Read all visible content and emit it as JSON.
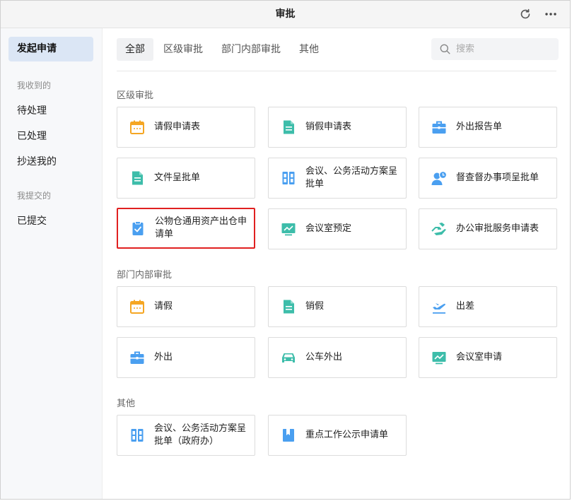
{
  "titlebar": {
    "title": "审批",
    "refresh_icon": "refresh-icon",
    "more_icon": "more-icon"
  },
  "sidebar": {
    "active": "发起申请",
    "group_received": "我收到的",
    "pending": "待处理",
    "processed": "已处理",
    "cc_me": "抄送我的",
    "group_submitted": "我提交的",
    "submitted": "已提交"
  },
  "tabs": [
    "全部",
    "区级审批",
    "部门内部审批",
    "其他"
  ],
  "search": {
    "placeholder": "搜索"
  },
  "sections": {
    "district": {
      "title": "区级审批",
      "cards": [
        {
          "label": "请假申请表",
          "icon": "calendar-icon"
        },
        {
          "label": "销假申请表",
          "icon": "document-icon"
        },
        {
          "label": "外出报告单",
          "icon": "briefcase-icon"
        },
        {
          "label": "文件呈批单",
          "icon": "document-icon"
        },
        {
          "label": "会议、公务活动方案呈批单",
          "icon": "columns-icon"
        },
        {
          "label": "督查督办事项呈批单",
          "icon": "user-clock-icon"
        },
        {
          "label": "公物仓通用资产出仓申请单",
          "icon": "clipboard-check-icon"
        },
        {
          "label": "会议室预定",
          "icon": "monitor-chart-icon"
        },
        {
          "label": "办公审批服务申请表",
          "icon": "hand-icon"
        }
      ]
    },
    "dept": {
      "title": "部门内部审批",
      "cards": [
        {
          "label": "请假",
          "icon": "calendar-icon"
        },
        {
          "label": "销假",
          "icon": "document-icon"
        },
        {
          "label": "出差",
          "icon": "airplane-icon"
        },
        {
          "label": "外出",
          "icon": "briefcase-icon"
        },
        {
          "label": "公车外出",
          "icon": "car-icon"
        },
        {
          "label": "会议室申请",
          "icon": "monitor-chart-icon"
        }
      ]
    },
    "other": {
      "title": "其他",
      "cards": [
        {
          "label": "会议、公务活动方案呈批单（政府办）",
          "icon": "columns-icon"
        },
        {
          "label": "重点工作公示申请单",
          "icon": "bookmark-icon"
        }
      ]
    }
  },
  "colors": {
    "accent_blue": "#4a9ff0",
    "teal": "#3dbdaa",
    "orange": "#f5a623",
    "highlight_red": "#e02020",
    "active_bg": "#dbe6f5"
  }
}
